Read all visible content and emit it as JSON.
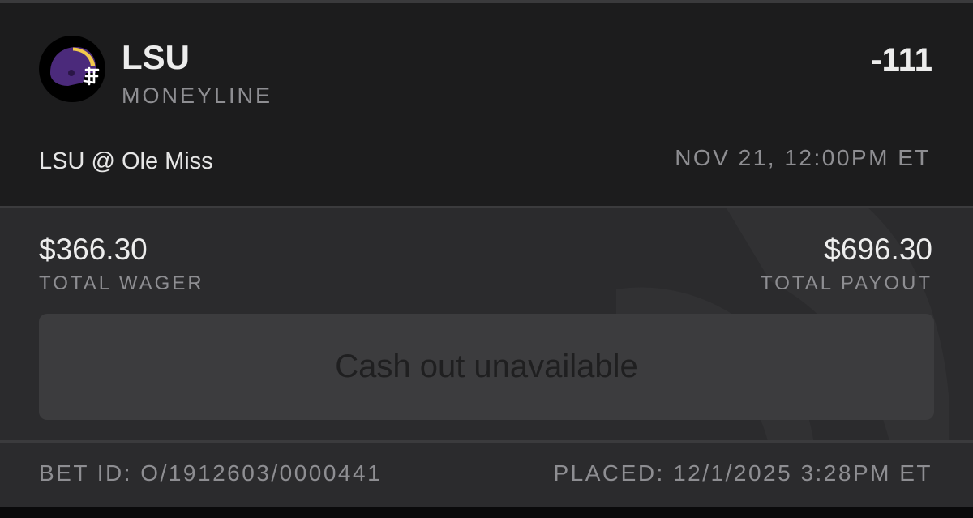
{
  "selection": {
    "team": "LSU",
    "bet_type": "MONEYLINE",
    "odds": "-111",
    "matchup": "LSU @ Ole Miss",
    "game_time": "NOV 21, 12:00PM ET",
    "logo_icon": "lsu-helmet-icon",
    "logo_colors": {
      "helmet": "#4b2a7b",
      "stripe": "#f2c94c",
      "facemask": "#ffffff"
    }
  },
  "wager": {
    "total_wager": "$366.30",
    "total_wager_label": "TOTAL WAGER",
    "total_payout": "$696.30",
    "total_payout_label": "TOTAL PAYOUT"
  },
  "cashout": {
    "label": "Cash out unavailable"
  },
  "footer": {
    "bet_id": "BET ID: O/1912603/0000441",
    "placed": "PLACED: 12/1/2025 3:28PM ET"
  }
}
